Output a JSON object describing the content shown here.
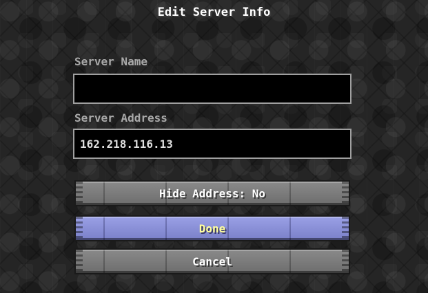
{
  "screen": {
    "title": "Edit Server Info"
  },
  "server_name": {
    "label": "Server Name",
    "value": ""
  },
  "server_address": {
    "label": "Server Address",
    "value": "162.218.116.13"
  },
  "buttons": {
    "hide_address": "Hide Address: No",
    "done": "Done",
    "cancel": "Cancel"
  },
  "colors": {
    "done_button_bg": "#8a90d8",
    "done_button_text": "#ffff9e",
    "stone_button_bg": "#7c7c7c",
    "label_text": "#a9a9a9"
  }
}
